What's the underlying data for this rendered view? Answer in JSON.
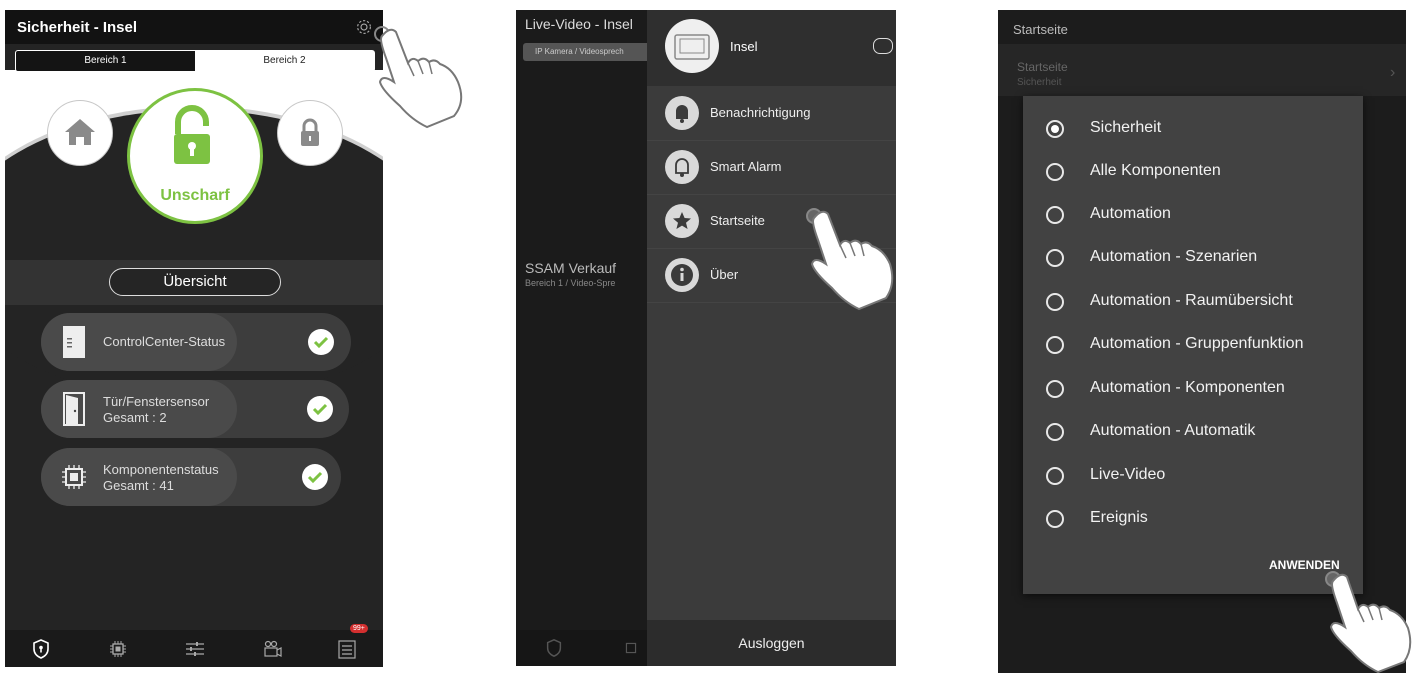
{
  "panel1": {
    "title": "Sicherheit - Insel",
    "tabs": [
      "Bereich 1",
      "Bereich 2"
    ],
    "arm_state": "Unscharf",
    "overview_label": "Übersicht",
    "status_items": [
      {
        "label": "ControlCenter-Status",
        "detail": ""
      },
      {
        "label": "Tür/Fenstersensor",
        "detail": "Gesamt : 2"
      },
      {
        "label": "Komponentenstatus",
        "detail": "Gesamt : 41"
      }
    ],
    "nav_badge": "99+",
    "accent_color": "#7dc242"
  },
  "panel2": {
    "bg_title": "Live-Video - Insel",
    "bg_tab": "IP Kamera / Videosprech",
    "bg_entry_title": "SSAM Verkauf",
    "bg_entry_sub": "Bereich 1 / Video-Spre",
    "drawer_name": "Insel",
    "menu": [
      {
        "label": "Benachrichtigung",
        "icon": "bell-icon"
      },
      {
        "label": "Smart Alarm",
        "icon": "bell-outline-icon"
      },
      {
        "label": "Startseite",
        "icon": "star-icon"
      },
      {
        "label": "Über",
        "icon": "info-icon"
      }
    ],
    "logout": "Ausloggen"
  },
  "panel3": {
    "title": "Startseite",
    "header_label": "Startseite",
    "header_value": "Sicherheit",
    "options": [
      "Sicherheit",
      "Alle Komponenten",
      "Automation",
      "Automation - Szenarien",
      "Automation - Raumübersicht",
      "Automation - Gruppenfunktion",
      "Automation - Komponenten",
      "Automation - Automatik",
      "Live-Video",
      "Ereignis"
    ],
    "selected_index": 0,
    "apply": "ANWENDEN"
  }
}
